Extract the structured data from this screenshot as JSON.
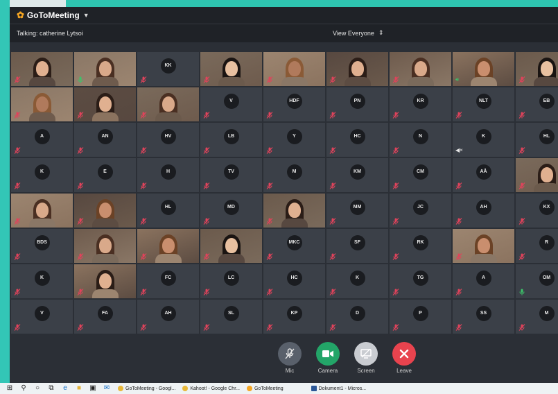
{
  "app": {
    "name": "GoToMeeting",
    "talking": "Talking: catherine Lytsoi",
    "view_mode": "View Everyone"
  },
  "colors": {
    "titlebar": "#1f2227",
    "tile": "#3b4048",
    "mic_muted": "#e0435b",
    "mic_active": "#3cc36a",
    "camera": "#23a568",
    "leave": "#e8434e",
    "screen": "#c9ccd1",
    "mic_btn": "#59606b"
  },
  "rows": [
    [
      {
        "v": 1,
        "m": "muted"
      },
      {
        "v": 1,
        "m": "active"
      },
      {
        "i": "KK",
        "m": "muted"
      },
      {
        "v": 1,
        "m": "muted"
      },
      {
        "v": 1,
        "m": "muted"
      },
      {
        "v": 1,
        "m": "muted"
      },
      {
        "v": 1,
        "m": "muted"
      },
      {
        "v": 1,
        "m": "speaker"
      },
      {
        "v": 1,
        "m": "muted"
      }
    ],
    [
      {
        "v": 1,
        "m": "muted"
      },
      {
        "v": 1,
        "m": "muted"
      },
      {
        "v": 1,
        "m": "muted"
      },
      {
        "i": "V",
        "m": "muted"
      },
      {
        "i": "HDF",
        "m": "muted"
      },
      {
        "i": "PN",
        "m": "muted"
      },
      {
        "i": "KR",
        "m": "muted"
      },
      {
        "i": "NLT",
        "m": "muted"
      },
      {
        "i": "EB",
        "m": "muted"
      }
    ],
    [
      {
        "i": "A",
        "m": "muted"
      },
      {
        "i": "AN",
        "m": "muted"
      },
      {
        "i": "HV",
        "m": "muted"
      },
      {
        "i": "LB",
        "m": "muted"
      },
      {
        "i": "Y",
        "m": "muted"
      },
      {
        "i": "HC",
        "m": "muted"
      },
      {
        "i": "N",
        "m": "muted"
      },
      {
        "i": "K",
        "m": "speaker_off"
      },
      {
        "i": "HL",
        "m": "muted"
      }
    ],
    [
      {
        "i": "K",
        "m": "muted"
      },
      {
        "i": "E",
        "m": "muted"
      },
      {
        "i": "H",
        "m": "muted"
      },
      {
        "i": "TV",
        "m": "muted"
      },
      {
        "i": "M",
        "m": "muted"
      },
      {
        "i": "KM",
        "m": "muted"
      },
      {
        "i": "CM",
        "m": "muted"
      },
      {
        "i": "AÅ",
        "m": "muted"
      },
      {
        "v": 1,
        "m": "muted"
      }
    ],
    [
      {
        "v": 1,
        "m": "muted"
      },
      {
        "v": 1,
        "m": "muted"
      },
      {
        "i": "HL",
        "m": "muted"
      },
      {
        "i": "MD",
        "m": "muted"
      },
      {
        "v": 1,
        "m": "muted"
      },
      {
        "i": "MM",
        "m": "muted"
      },
      {
        "i": "JC",
        "m": "muted"
      },
      {
        "i": "AH",
        "m": "muted"
      },
      {
        "i": "KX",
        "m": "muted"
      }
    ],
    [
      {
        "i": "BDS",
        "m": "muted"
      },
      {
        "v": 1,
        "m": "muted"
      },
      {
        "v": 1,
        "m": "muted"
      },
      {
        "v": 1,
        "m": "muted"
      },
      {
        "i": "MKC",
        "m": "muted"
      },
      {
        "i": "SF",
        "m": "muted"
      },
      {
        "i": "RK",
        "m": "muted"
      },
      {
        "v": 1,
        "m": "muted"
      },
      {
        "i": "R",
        "m": "muted"
      }
    ],
    [
      {
        "i": "K",
        "m": "muted"
      },
      {
        "v": 1,
        "m": "muted"
      },
      {
        "i": "FC",
        "m": "muted"
      },
      {
        "i": "LC",
        "m": "muted"
      },
      {
        "i": "HC",
        "m": "muted"
      },
      {
        "i": "K",
        "m": "muted"
      },
      {
        "i": "TG",
        "m": "muted"
      },
      {
        "i": "A",
        "m": "muted"
      },
      {
        "i": "OM",
        "m": "active"
      }
    ],
    [
      {
        "i": "V",
        "m": "muted"
      },
      {
        "i": "FA",
        "m": "muted"
      },
      {
        "i": "AH",
        "m": "muted"
      },
      {
        "i": "SL",
        "m": "muted"
      },
      {
        "i": "KP",
        "m": "muted"
      },
      {
        "i": "D",
        "m": "muted"
      },
      {
        "i": "P",
        "m": "muted"
      },
      {
        "i": "SS",
        "m": "muted"
      },
      {
        "i": "M",
        "m": "muted"
      }
    ]
  ],
  "controls": {
    "mic": "Mic",
    "camera": "Camera",
    "screen": "Screen",
    "leave": "Leave"
  },
  "taskbar": {
    "items": [
      "GoToMeeting - Googl...",
      "Kahoot! - Google Chr...",
      "GoToMeeting",
      "Dokument1 - Micros..."
    ]
  }
}
